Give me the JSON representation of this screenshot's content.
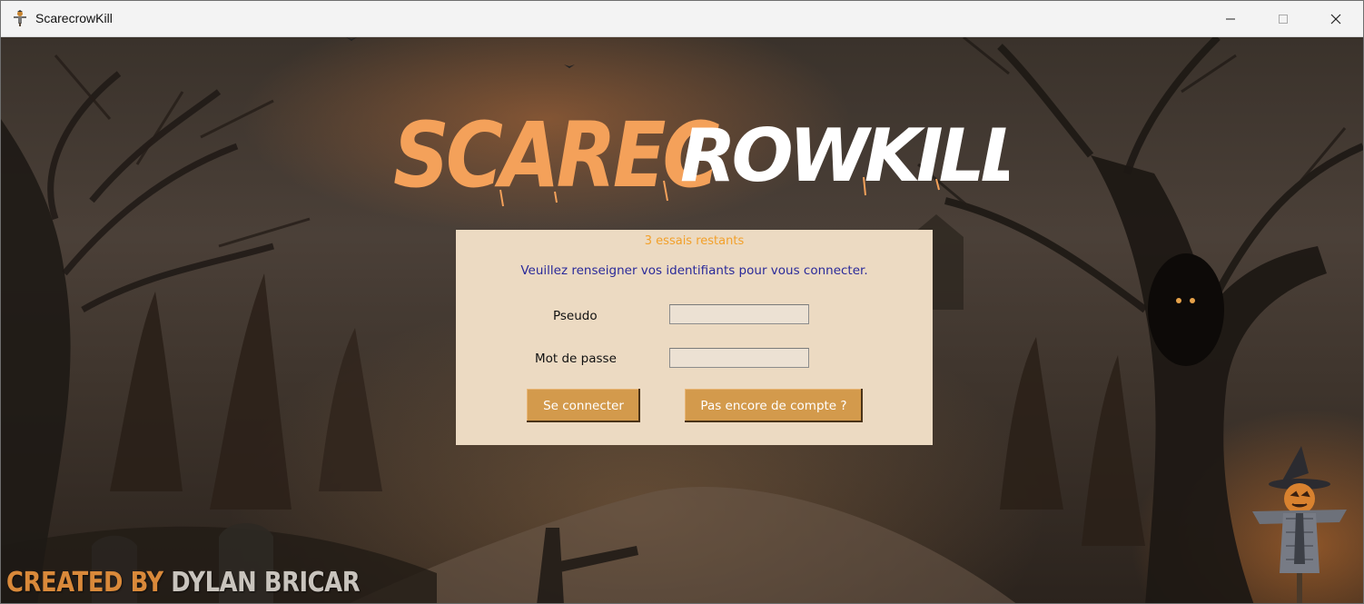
{
  "window": {
    "title": "ScarecrowKill",
    "icon": "scarecrow-app-icon",
    "controls": [
      "minimize-icon",
      "maximize-icon",
      "close-icon"
    ]
  },
  "logo": {
    "part1": "SCAREC",
    "part2": "ROWKILL",
    "color_part1": "#f4a15a",
    "color_part2": "#ffffff"
  },
  "login": {
    "tries_text": "3 essais restants",
    "instructions": "Veuillez renseigner vos identifiants pour vous connecter.",
    "pseudo_label": "Pseudo",
    "pseudo_value": "",
    "password_label": "Mot de passe",
    "password_value": "",
    "login_button": "Se connecter",
    "register_button": "Pas encore de compte ?"
  },
  "footer": {
    "credit_prefix": "CREATED BY",
    "credit_name": "DYLAN BRICAR"
  },
  "colors": {
    "panel_bg": "#ecdac2",
    "button_bg": "#d39a4c",
    "tries_text": "#f2a02a",
    "instructions_text": "#2a2a9a"
  }
}
